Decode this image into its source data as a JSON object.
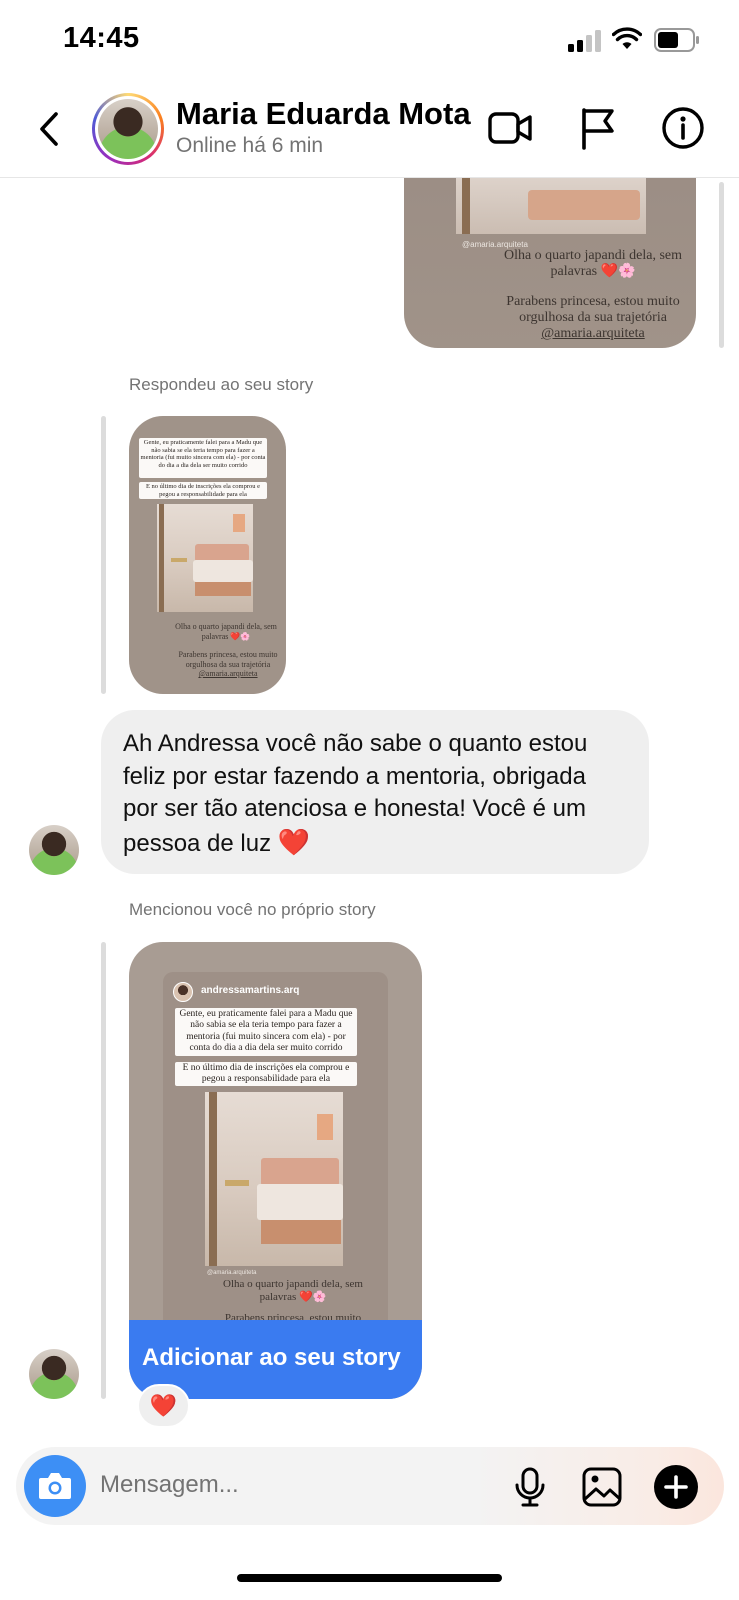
{
  "status_bar": {
    "time": "14:45"
  },
  "header": {
    "contact_name": "Maria Eduarda Mota",
    "contact_status": "Online há 6 min"
  },
  "sent_story": {
    "handle": "@amaria.arquiteta",
    "line1": "Olha o quarto japandi dela, sem palavras ❤️🌸",
    "line2": "Parabens princesa, estou muito orgulhosa da sua trajetória",
    "tag": "@amaria.arquiteta"
  },
  "reply_story": {
    "label": "Respondeu ao seu story",
    "text1": "Gente, eu praticamente falei para a Madu que não sabia se ela teria tempo para fazer a mentoria (fui muito sincera com ela) - por conta do dia a dia dela ser muito corrido",
    "text2": "E no último dia de inscrições ela comprou e pegou a responsabilidade para ela",
    "text3": "Olha o quarto japandi dela, sem palavras ❤️🌸",
    "text4": "Parabens princesa, estou muito orgulhosa da sua trajetória",
    "tag": "@amaria.arquiteta"
  },
  "message": {
    "text": "Ah Andressa você não sabe o quanto estou feliz por estar fazendo a mentoria, obrigada por ser tão atenciosa e honesta! Você é um pessoa de luz",
    "emoji": "❤️"
  },
  "mention_story": {
    "label": "Mencionou você no próprio story",
    "username": "andressamartins.arq",
    "text1": "Gente, eu praticamente falei para a Madu que não sabia se ela teria tempo para fazer a mentoria (fui muito sincera com ela) - por conta do dia a dia dela ser muito corrido",
    "text2": "E no último dia de inscrições ela comprou e pegou a responsabilidade para ela",
    "handle": "@amaria.arquiteta",
    "text3": "Olha o quarto japandi dela, sem palavras ❤️🌸",
    "text4": "Parabens princesa, estou muito",
    "button_label": "Adicionar ao seu story",
    "reaction": "❤️"
  },
  "composer": {
    "placeholder": "Mensagem..."
  },
  "colors": {
    "accent_blue": "#3a7bf0",
    "camera_blue": "#3d8ff5",
    "heart_red": "#e01b2f"
  },
  "icons": [
    "back-icon",
    "video-call-icon",
    "flag-icon",
    "info-icon",
    "camera-icon",
    "microphone-icon",
    "gallery-icon",
    "plus-icon"
  ]
}
